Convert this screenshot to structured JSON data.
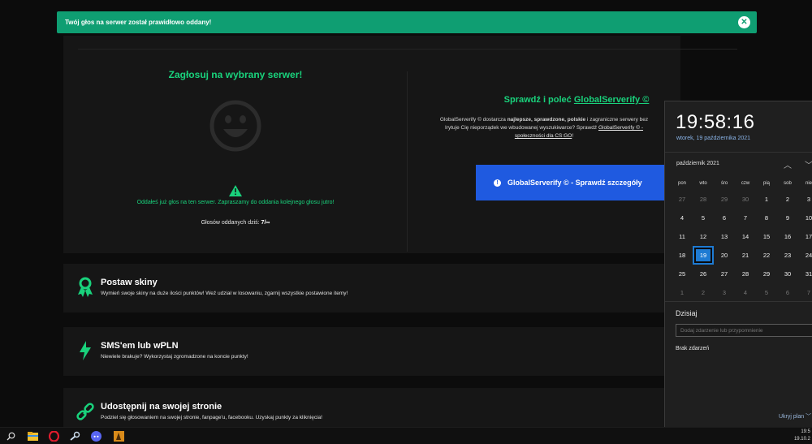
{
  "toast": {
    "message": "Twój głos na serwer został prawidłowo oddany!"
  },
  "vote": {
    "title": "Zagłosuj na wybrany serwer!",
    "already_voted": "Oddałeś już głos na ten serwer. Zapraszamy do oddania kolejnego głosu jutro!",
    "count_label": "Głosów oddanych dziś:",
    "count_value": "7/∞"
  },
  "promo": {
    "title_prefix": "Sprawdź i poleć",
    "title_link": "GlobalServerify ©",
    "desc_line1_a": "GlobalServerify © dostarcza",
    "desc_line1_b": "najlepsze, sprawdzone, polskie",
    "desc_line1_c": "i zagraniczne serwery bez",
    "desc_line2_a": "Irytuje Cię nieporządek we wbudowanej wyszukiwarce? Sprawdź",
    "desc_line2_link": "GlobalServerify © -",
    "desc_line3_link": "społeczności dla CS:GO",
    "desc_line3_end": "!",
    "button_label": "GlobalServerify © - Sprawdź szczegóły"
  },
  "cards": [
    {
      "title": "Postaw skiny",
      "desc": "Wymień swoje skiny na duże ilości punktów! Weź udział w losowaniu, zgarnij wszystkie postawione itemy!"
    },
    {
      "title": "SMS'em lub wPLN",
      "desc": "Niewiele brakuje? Wykorzystaj zgromadzone na koncie punkty!"
    },
    {
      "title": "Udostępnij na swojej stronie",
      "desc": "Podziel się głosowaniem na swojej stronie, fanpage'u, facebooku. Uzyskaj punkty za kliknięcia!"
    }
  ],
  "calendar": {
    "time": "19:58:16",
    "date_long": "wtorek, 19 października 2021",
    "month": "październik 2021",
    "weekdays": [
      "pon",
      "wto",
      "śro",
      "czw",
      "pią",
      "sob",
      "nie"
    ],
    "weeks": [
      [
        "27",
        "28",
        "29",
        "30",
        "1",
        "2",
        "3"
      ],
      [
        "4",
        "5",
        "6",
        "7",
        "8",
        "9",
        "10"
      ],
      [
        "11",
        "12",
        "13",
        "14",
        "15",
        "16",
        "17"
      ],
      [
        "18",
        "19",
        "20",
        "21",
        "22",
        "23",
        "24"
      ],
      [
        "25",
        "26",
        "27",
        "28",
        "29",
        "30",
        "31"
      ],
      [
        "1",
        "2",
        "3",
        "4",
        "5",
        "6",
        "7"
      ]
    ],
    "today_label": "Dzisiaj",
    "event_placeholder": "Dodaj zdarzenie lub przypomnienie",
    "no_events": "Brak zdarzeń",
    "hide_plan": "Ukryj plan"
  },
  "taskbar": {
    "time": "19:5",
    "date": "19.10.2"
  },
  "colors": {
    "accent": "#19d27c",
    "toast": "#0f9e72",
    "button": "#1f5ae0",
    "today": "#1e7bd3"
  }
}
